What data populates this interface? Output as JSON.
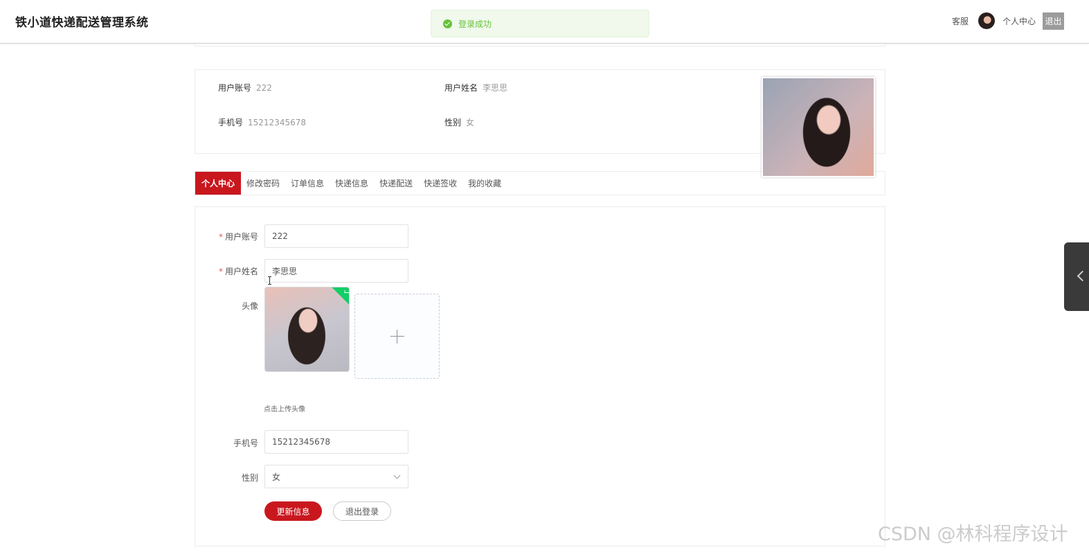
{
  "header": {
    "site_title": "铁小道快递配送管理系统",
    "toast": "登录成功",
    "customer_service": "客服",
    "user_center": "个人中心",
    "logout": "退出"
  },
  "profile_summary": {
    "account_label": "用户账号",
    "account_value": "222",
    "name_label": "用户姓名",
    "name_value": "李思思",
    "phone_label": "手机号",
    "phone_value": "15212345678",
    "gender_label": "性别",
    "gender_value": "女"
  },
  "tabs": [
    {
      "label": "个人中心",
      "active": true
    },
    {
      "label": "修改密码",
      "active": false
    },
    {
      "label": "订单信息",
      "active": false
    },
    {
      "label": "快递信息",
      "active": false
    },
    {
      "label": "快递配送",
      "active": false
    },
    {
      "label": "快递签收",
      "active": false
    },
    {
      "label": "我的收藏",
      "active": false
    }
  ],
  "form": {
    "account_label": "用户账号",
    "account_value": "222",
    "name_label": "用户姓名",
    "name_value": "李思思",
    "avatar_label": "头像",
    "upload_hint": "点击上传头像",
    "phone_label": "手机号",
    "phone_value": "15212345678",
    "gender_label": "性别",
    "gender_value": "女",
    "update_button": "更新信息",
    "logout_button": "退出登录"
  },
  "watermark": "CSDN @林科程序设计",
  "colors": {
    "accent": "#c9171e",
    "success": "#67c23a",
    "upload_check": "#13ce66"
  }
}
